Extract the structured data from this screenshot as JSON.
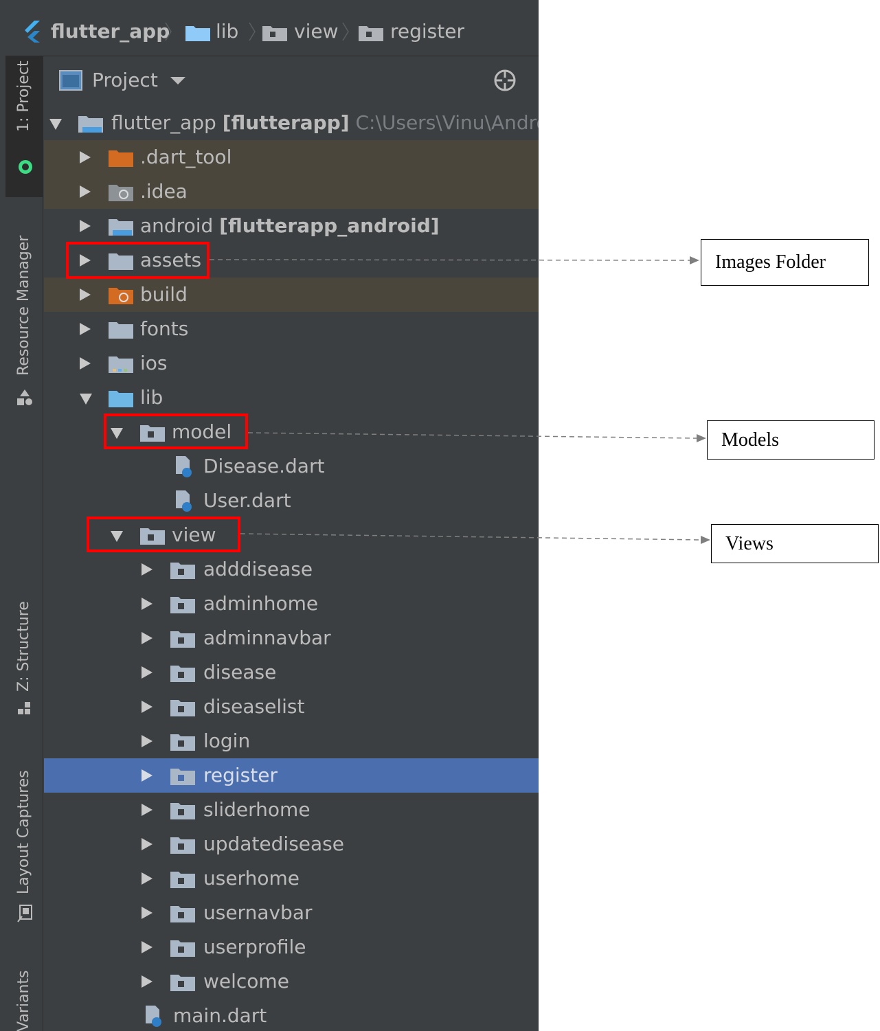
{
  "breadcrumb": [
    {
      "label": "flutter_app",
      "icon": "flutter-icon"
    },
    {
      "label": "lib",
      "icon": "folder-icon"
    },
    {
      "label": "view",
      "icon": "package-folder-icon"
    },
    {
      "label": "register",
      "icon": "package-folder-icon"
    }
  ],
  "side_tabs": {
    "project": "1: Project",
    "resource_manager": "Resource Manager",
    "structure": "Z: Structure",
    "layout_captures": "Layout Captures",
    "build_variants": "Variants"
  },
  "panel": {
    "title": "Project",
    "locate_icon": "crosshair-icon"
  },
  "tree": {
    "root": {
      "name": "flutter_app",
      "module": "[flutterapp]",
      "path": "C:\\Users\\Vinu\\Androic"
    },
    "dart_tool": ".dart_tool",
    "idea": ".idea",
    "android": {
      "name": "android",
      "module": "[flutterapp_android]"
    },
    "assets": "assets",
    "build": "build",
    "fonts": "fonts",
    "ios": "ios",
    "lib": "lib",
    "model": "model",
    "disease_dart": "Disease.dart",
    "user_dart": "User.dart",
    "view": "view",
    "view_children": [
      "adddisease",
      "adminhome",
      "adminnavbar",
      "disease",
      "diseaselist",
      "login",
      "register",
      "sliderhome",
      "updatedisease",
      "userhome",
      "usernavbar",
      "userprofile",
      "welcome"
    ],
    "main_dart": "main.dart"
  },
  "annotations": {
    "images_folder": "Images Folder",
    "models": "Models",
    "views": "Views"
  },
  "colors": {
    "background": "#3c3f41",
    "selection": "#4b6eaf",
    "excluded": "#4b463b",
    "highlight_box": "#ff0000"
  }
}
